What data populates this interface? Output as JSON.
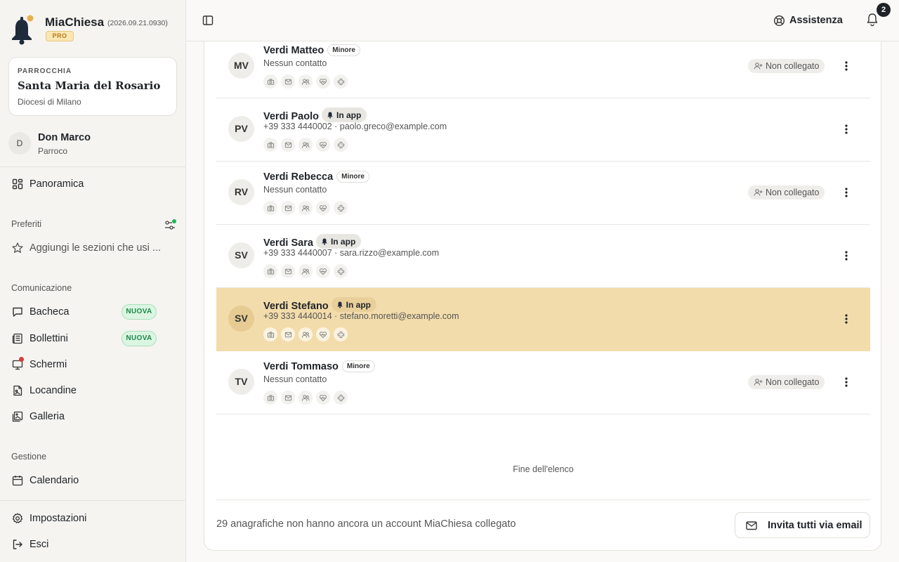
{
  "brand": {
    "name": "MiaChiesa",
    "version": "(2026.09.21.0930)",
    "plan": "PRO"
  },
  "parish": {
    "label": "PARROCCHIA",
    "name": "Santa Maria del Rosario",
    "diocese": "Diocesi di Milano"
  },
  "user": {
    "initial": "D",
    "name": "Don Marco",
    "role": "Parroco"
  },
  "nav": {
    "overview": "Panoramica",
    "favorites_title": "Preferiti",
    "favorites_placeholder": "Aggiungi le sezioni che usi ...",
    "communication_title": "Comunicazione",
    "communication": [
      {
        "label": "Bacheca",
        "badge": "NUOVA",
        "icon": "chat-icon"
      },
      {
        "label": "Bollettini",
        "badge": "NUOVA",
        "icon": "newspaper-icon"
      },
      {
        "label": "Schermi",
        "badge": "",
        "icon": "screen-icon"
      },
      {
        "label": "Locandine",
        "badge": "",
        "icon": "poster-icon"
      },
      {
        "label": "Galleria",
        "badge": "",
        "icon": "gallery-icon"
      }
    ],
    "management_title": "Gestione",
    "management": [
      {
        "label": "Calendario",
        "icon": "calendar-icon"
      }
    ],
    "settings": "Impostazioni",
    "logout": "Esci"
  },
  "topbar": {
    "help_label": "Assistenza",
    "notifications_count": "2"
  },
  "rows": [
    {
      "initials": "MV",
      "name": "Verdi Matteo",
      "tag": "Minore",
      "tag_type": "minor",
      "contact": "Nessun contatto",
      "status": "Non collegato",
      "highlight": false
    },
    {
      "initials": "PV",
      "name": "Verdi Paolo",
      "tag": "In app",
      "tag_type": "app",
      "contact": "+39 333 4440002 · paolo.greco@example.com",
      "status": "",
      "highlight": false
    },
    {
      "initials": "RV",
      "name": "Verdi Rebecca",
      "tag": "Minore",
      "tag_type": "minor",
      "contact": "Nessun contatto",
      "status": "Non collegato",
      "highlight": false
    },
    {
      "initials": "SV",
      "name": "Verdi Sara",
      "tag": "In app",
      "tag_type": "app",
      "contact": "+39 333 4440007 · sara.rizzo@example.com",
      "status": "",
      "highlight": false
    },
    {
      "initials": "SV",
      "name": "Verdi Stefano",
      "tag": "In app",
      "tag_type": "app",
      "contact": "+39 333 4440014 · stefano.moretti@example.com",
      "status": "",
      "highlight": true
    },
    {
      "initials": "TV",
      "name": "Verdi Tommaso",
      "tag": "Minore",
      "tag_type": "minor",
      "contact": "Nessun contatto",
      "status": "Non collegato",
      "highlight": false
    }
  ],
  "list": {
    "end_label": "Fine dell'elenco",
    "footer_text": "29 anagrafiche non hanno ancora un account MiaChiesa collegato",
    "invite_label": "Invita tutti via email"
  },
  "colors": {
    "highlight": "#f3dcab",
    "new_badge": "#1b8a47",
    "alert_dot": "#d93a3a",
    "logo_dot": "#e8b04a"
  }
}
